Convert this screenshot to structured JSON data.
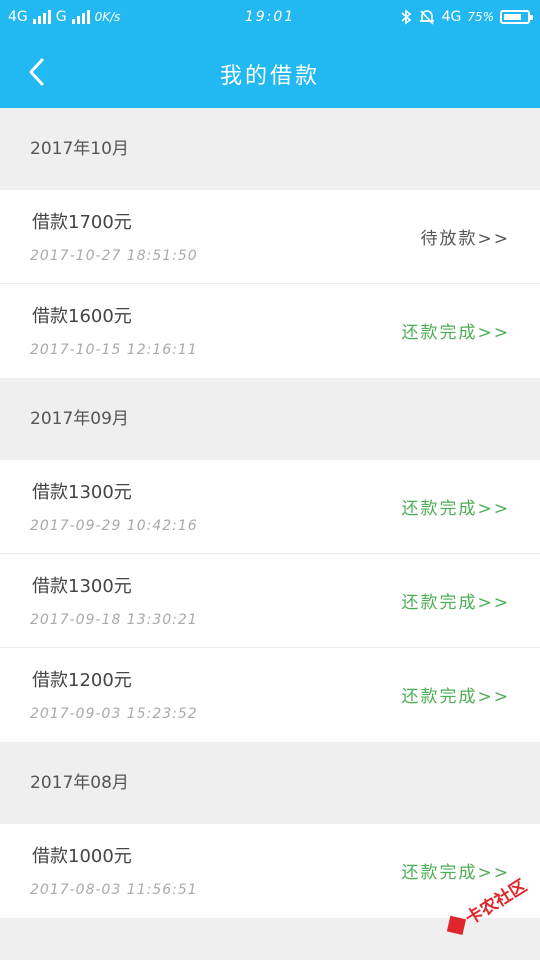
{
  "status_bar": {
    "network1": "4G",
    "network2": "G",
    "speed": "0K/s",
    "time": "19:01",
    "network3": "4G",
    "battery_percent": "75%",
    "battery_level": 0.75
  },
  "nav": {
    "title": "我的借款"
  },
  "months": [
    {
      "label": "2017年10月",
      "loans": [
        {
          "amount": "借款1700元",
          "time": "2017-10-27 18:51:50",
          "status": "待放款>>",
          "status_type": "pending"
        },
        {
          "amount": "借款1600元",
          "time": "2017-10-15 12:16:11",
          "status": "还款完成>>",
          "status_type": "done"
        }
      ]
    },
    {
      "label": "2017年09月",
      "loans": [
        {
          "amount": "借款1300元",
          "time": "2017-09-29 10:42:16",
          "status": "还款完成>>",
          "status_type": "done"
        },
        {
          "amount": "借款1300元",
          "time": "2017-09-18 13:30:21",
          "status": "还款完成>>",
          "status_type": "done"
        },
        {
          "amount": "借款1200元",
          "time": "2017-09-03 15:23:52",
          "status": "还款完成>>",
          "status_type": "done"
        }
      ]
    },
    {
      "label": "2017年08月",
      "loans": [
        {
          "amount": "借款1000元",
          "time": "2017-08-03 11:56:51",
          "status": "还款完成>>",
          "status_type": "done"
        }
      ]
    }
  ],
  "watermark": {
    "text": "卡农社区"
  },
  "colors": {
    "header": "#22b9f3",
    "done": "#4cae55",
    "watermark": "#e0262b"
  }
}
